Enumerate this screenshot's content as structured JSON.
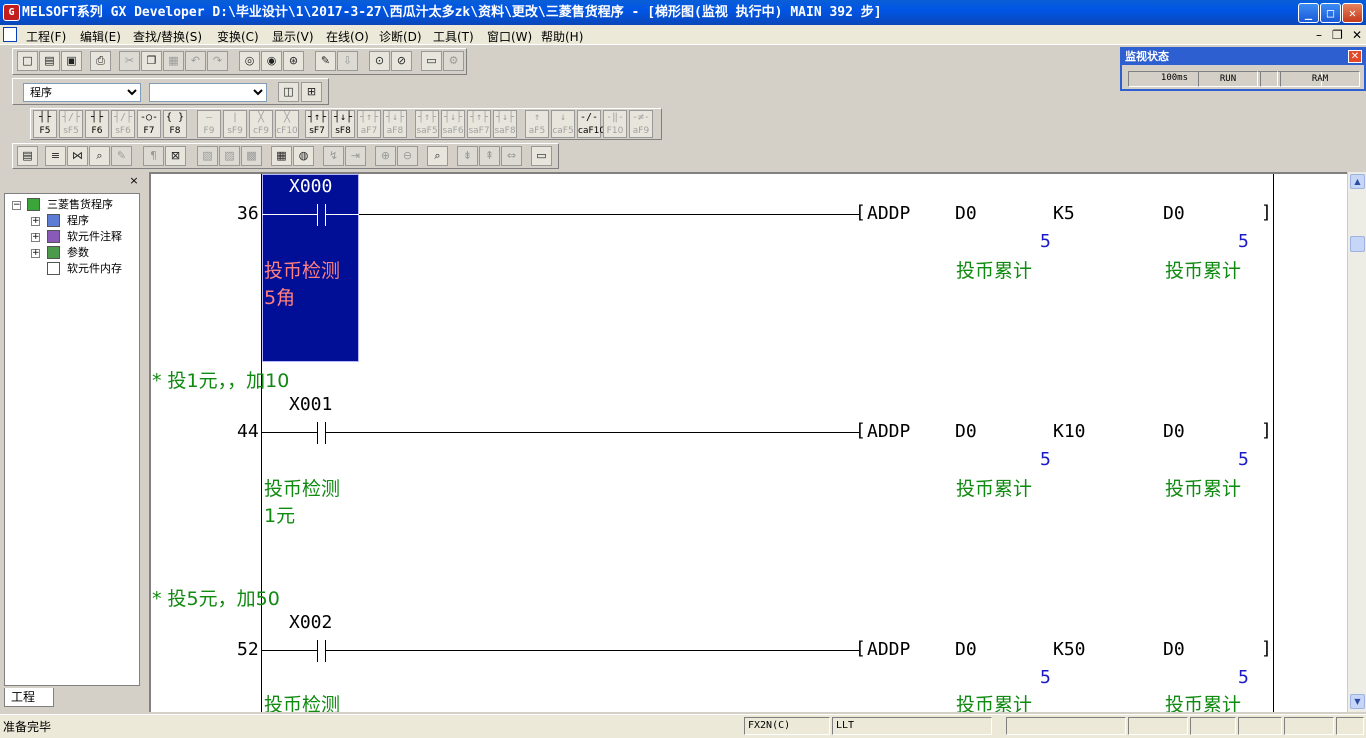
{
  "window": {
    "title": "MELSOFT系列 GX Developer D:\\毕业设计\\1\\2017-3-27\\西瓜汁太多zk\\资料\\更改\\三菱售货程序 - [梯形图(监视 执行中)      MAIN     392 步]",
    "min": "_",
    "max": "□",
    "close": "✕"
  },
  "menu": {
    "items": [
      "工程(F)",
      "编辑(E)",
      "查找/替换(S)",
      "变换(C)",
      "显示(V)",
      "在线(O)",
      "诊断(D)",
      "工具(T)",
      "窗口(W)",
      "帮助(H)"
    ],
    "mdi_min": "–",
    "mdi_restore": "❐",
    "mdi_close": "✕"
  },
  "combos": {
    "left_value": "程序",
    "right_value": ""
  },
  "ladder_keys": [
    {
      "sym": "┤├",
      "label": "F5",
      "dim": false
    },
    {
      "sym": "┤/├",
      "label": "sF5",
      "dim": true
    },
    {
      "sym": "┤├",
      "label": "F6",
      "dim": false
    },
    {
      "sym": "┤/├",
      "label": "sF6",
      "dim": true
    },
    {
      "sym": "-○-",
      "label": "F7",
      "dim": false
    },
    {
      "sym": "{ }",
      "label": "F8",
      "dim": false
    },
    {
      "sym": "—",
      "label": "F9",
      "dim": true
    },
    {
      "sym": "|",
      "label": "sF9",
      "dim": true
    },
    {
      "sym": "╳",
      "label": "cF9",
      "dim": true
    },
    {
      "sym": "╳",
      "label": "cF10",
      "dim": true
    },
    {
      "sym": "┤↑├",
      "label": "sF7",
      "dim": false
    },
    {
      "sym": "┤↓├",
      "label": "sF8",
      "dim": false
    },
    {
      "sym": "┤↑├",
      "label": "aF7",
      "dim": true
    },
    {
      "sym": "┤↓├",
      "label": "aF8",
      "dim": true
    },
    {
      "sym": "┤↑├",
      "label": "saF5",
      "dim": true
    },
    {
      "sym": "┤↓├",
      "label": "saF6",
      "dim": true
    },
    {
      "sym": "┤↑├",
      "label": "saF7",
      "dim": true
    },
    {
      "sym": "┤↓├",
      "label": "saF8",
      "dim": true
    },
    {
      "sym": "↑",
      "label": "aF5",
      "dim": true
    },
    {
      "sym": "↓",
      "label": "caF5",
      "dim": true
    },
    {
      "sym": "-/-",
      "label": "caF10",
      "dim": false
    },
    {
      "sym": "-‖-",
      "label": "F10",
      "dim": true
    },
    {
      "sym": "-≠-",
      "label": "aF9",
      "dim": true
    }
  ],
  "monitor": {
    "title": "监视状态",
    "close": "✕",
    "scan_time": "100ms",
    "state": "RUN",
    "memory": "RAM"
  },
  "project_panel": {
    "close": "×",
    "root": "三菱售货程序",
    "items": [
      "程序",
      "软元件注释",
      "参数",
      "软元件内存"
    ],
    "tab": "工程",
    "pm_collapse": "−",
    "pm_expand": "+"
  },
  "ladder": {
    "rungs": [
      {
        "step": "36",
        "contact": "X000",
        "comment_line1": "投币检测",
        "comment_line2": "5角",
        "instruction": "ADDP",
        "op1": "D0",
        "op2": "K5",
        "op3": "D0",
        "op1_value": "5",
        "op3_value": "5",
        "op1_comment": "投币累计",
        "op3_comment": "投币累计",
        "bracket_open": "[",
        "bracket_close": "]"
      },
      {
        "statement": "* 投1元，，加10",
        "step": "44",
        "contact": "X001",
        "comment_line1": "投币检测",
        "comment_line2": "1元",
        "instruction": "ADDP",
        "op1": "D0",
        "op2": "K10",
        "op3": "D0",
        "op1_value": "5",
        "op3_value": "5",
        "op1_comment": "投币累计",
        "op3_comment": "投币累计",
        "bracket_open": "[",
        "bracket_close": "]"
      },
      {
        "statement": "* 投5元，加50",
        "step": "52",
        "contact": "X002",
        "comment_line1": "投币检测",
        "instruction": "ADDP",
        "op1": "D0",
        "op2": "K50",
        "op3": "D0",
        "op1_value": "5",
        "op3_value": "5",
        "op1_comment": "投币累计",
        "op3_comment": "投币累计",
        "bracket_open": "[",
        "bracket_close": "]"
      }
    ]
  },
  "scrollbar": {
    "up": "▲",
    "down": "▼"
  },
  "status": {
    "message": "准备完毕",
    "plc_type": "FX2N(C)",
    "mode": "LLT"
  },
  "colors": {
    "titlebar": "#0055e5",
    "selection": "#000f96",
    "comment_green": "#118a11",
    "value_blue": "#1a1ac8",
    "comment_on_select": "#ff7f7f"
  }
}
